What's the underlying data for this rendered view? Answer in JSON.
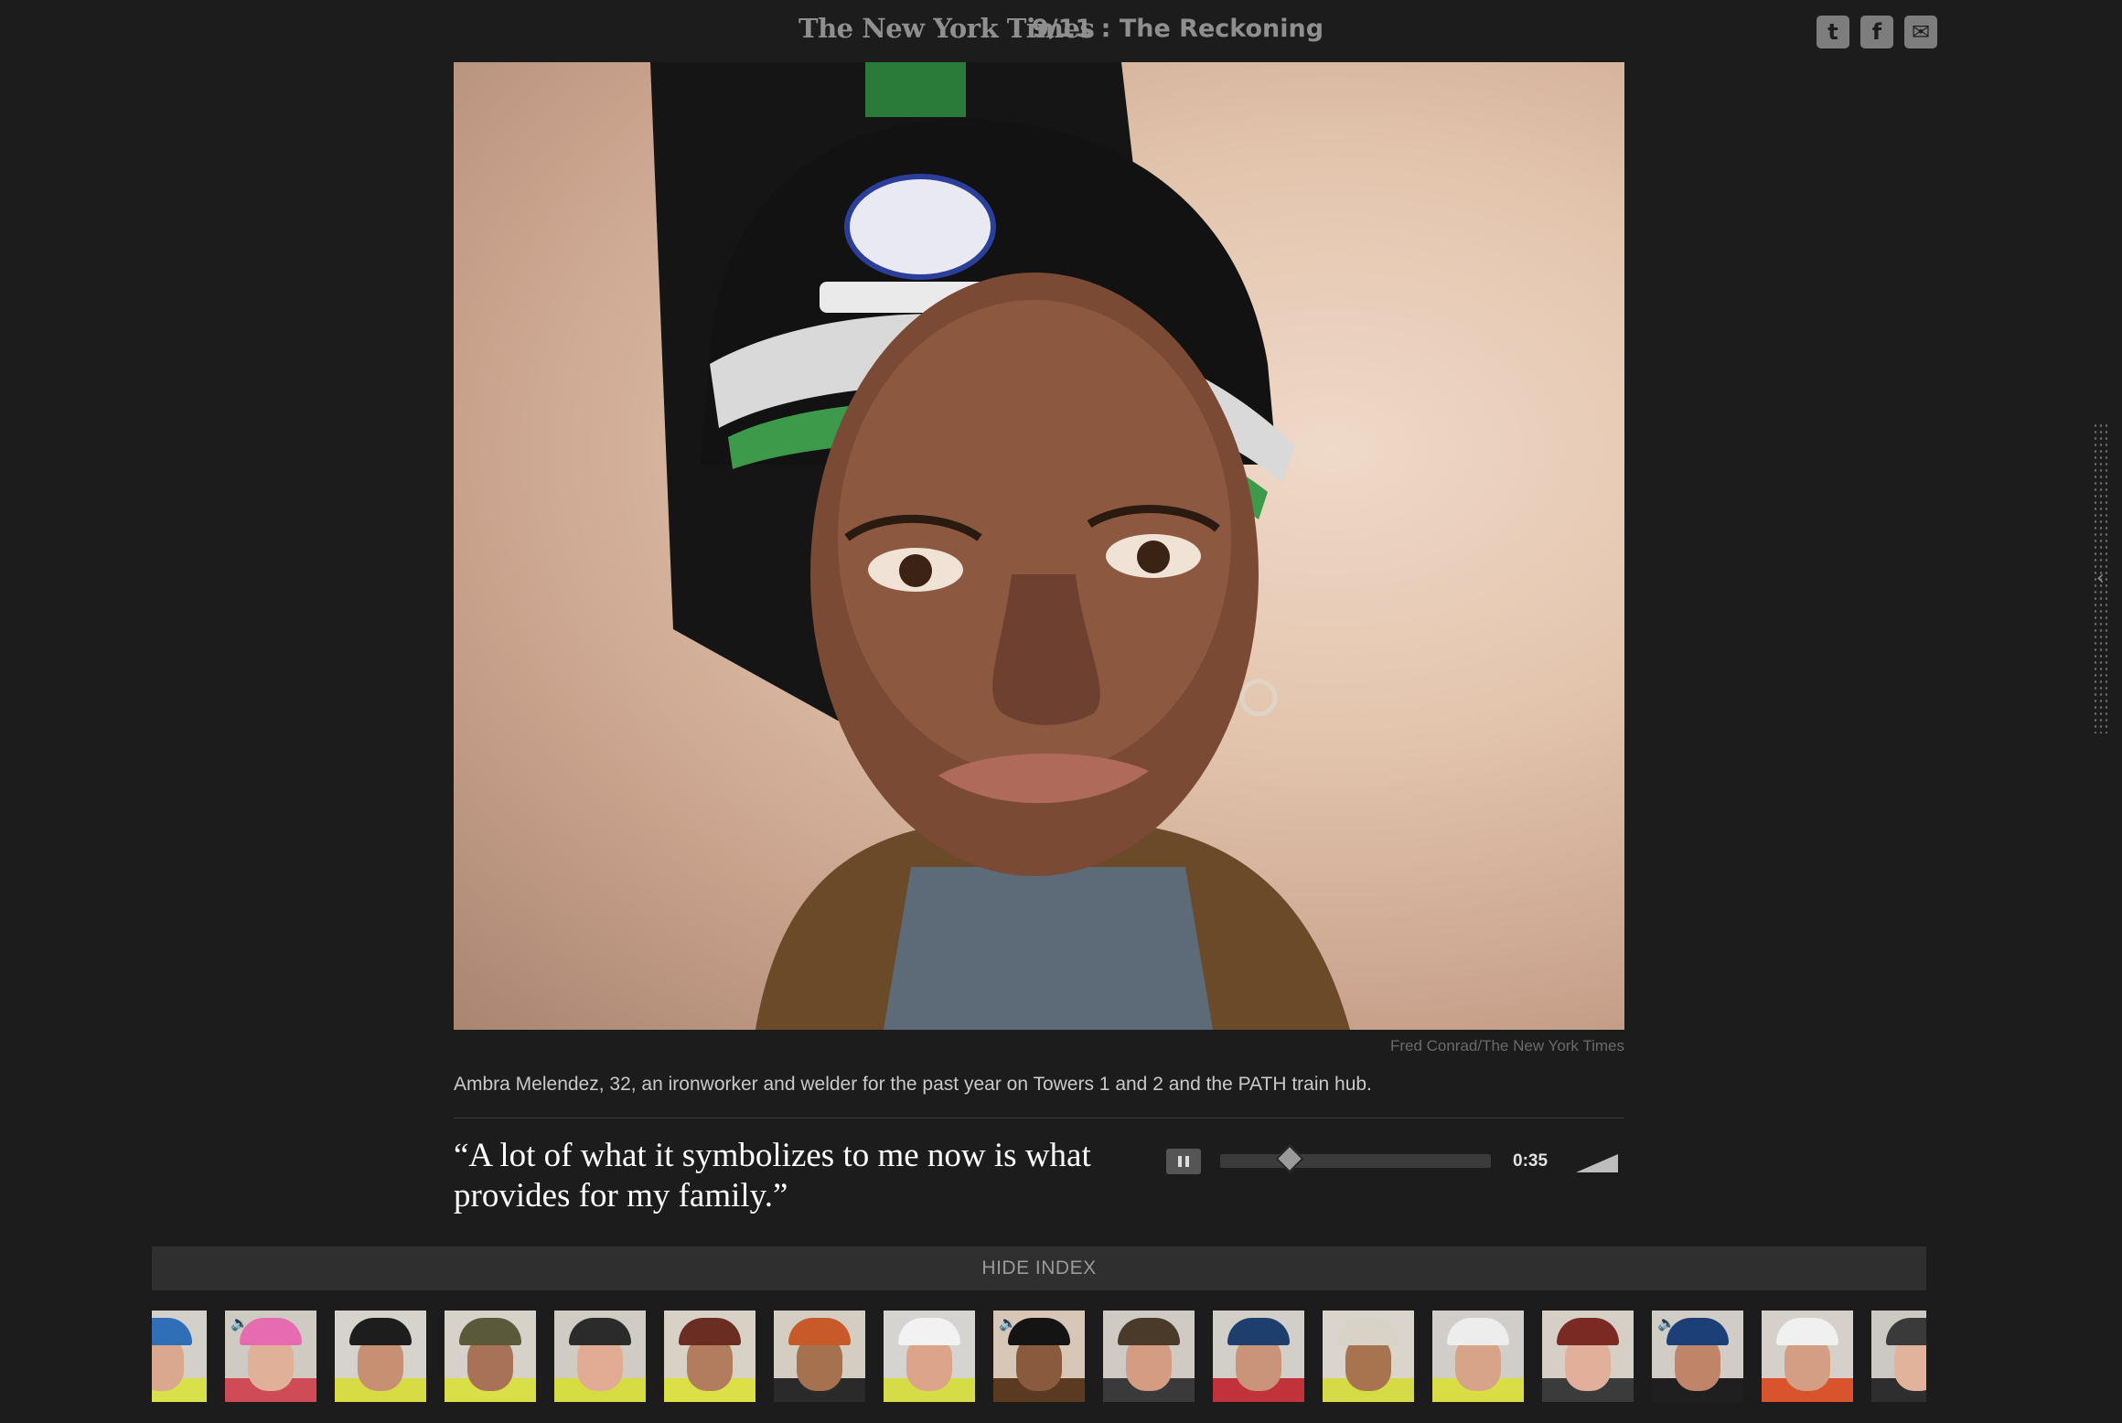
{
  "header": {
    "masthead": "The New York Times",
    "series_title": "9/11 : The Reckoning",
    "share": [
      {
        "icon": "twitter-icon",
        "glyph": "t"
      },
      {
        "icon": "facebook-icon",
        "glyph": "f"
      },
      {
        "icon": "email-icon",
        "glyph": "✉"
      }
    ]
  },
  "photo": {
    "credit": "Fred Conrad/The New York Times",
    "caption": "Ambra Melendez, 32, an ironworker and welder for the past year on Towers 1 and 2 and the PATH train hub."
  },
  "quote": "“A lot of what it symbolizes to me now is what provides for my family.”",
  "audio": {
    "state": "playing",
    "elapsed": "0:35",
    "progress": 0.25
  },
  "index": {
    "toggle_label": "HIDE INDEX"
  },
  "thumbnails": [
    {
      "hat": "#2f6fb8",
      "skin": "#d9a88e",
      "vest": "#d8e04a",
      "bg": "#d3cfc9",
      "audio": false,
      "partial": true
    },
    {
      "hat": "#e76bb0",
      "skin": "#e0b098",
      "vest": "#cf4b55",
      "bg": "#cfcac2",
      "audio": true
    },
    {
      "hat": "#1d1d1d",
      "skin": "#c89072",
      "vest": "#d7dc44",
      "bg": "#d6d3cd",
      "audio": false
    },
    {
      "hat": "#5a5a3a",
      "skin": "#a87256",
      "vest": "#d9df46",
      "bg": "#d6d1c9",
      "audio": false
    },
    {
      "hat": "#2b2b2b",
      "skin": "#e2ac94",
      "vest": "#d6dd43",
      "bg": "#d0ccc4",
      "audio": false
    },
    {
      "hat": "#6b2c22",
      "skin": "#b27c5e",
      "vest": "#dbe047",
      "bg": "#d8d2c6",
      "audio": false
    },
    {
      "hat": "#c85a2a",
      "skin": "#a5714f",
      "vest": "#2a2a2a",
      "bg": "#d4cdc2",
      "audio": false
    },
    {
      "hat": "#f2f2f2",
      "skin": "#dca58a",
      "vest": "#d6dc45",
      "bg": "#d6d4d0",
      "audio": false
    },
    {
      "hat": "#141414",
      "skin": "#8a5a3c",
      "vest": "#5b3a22",
      "bg": "#d8c7b7",
      "audio": true
    },
    {
      "hat": "#4a3a2a",
      "skin": "#d49c80",
      "vest": "#3a3a3a",
      "bg": "#cfcbc4",
      "audio": false
    },
    {
      "hat": "#1e3f6e",
      "skin": "#c99478",
      "vest": "#c2323a",
      "bg": "#d2cec8",
      "audio": false
    },
    {
      "hat": "#d9d2c7",
      "skin": "#a8744f",
      "vest": "#d4db46",
      "bg": "#d9d5cd",
      "audio": false
    },
    {
      "hat": "#ededed",
      "skin": "#d7a488",
      "vest": "#d8de44",
      "bg": "#d1cec9",
      "audio": false
    },
    {
      "hat": "#7a2a22",
      "skin": "#e2b09a",
      "vest": "#3b3b3b",
      "bg": "#d5cfc6",
      "audio": false
    },
    {
      "hat": "#1c3f78",
      "skin": "#c08468",
      "vest": "#1f1f1f",
      "bg": "#d1ccc5",
      "audio": true
    },
    {
      "hat": "#f0f0f0",
      "skin": "#d49e82",
      "vest": "#d9542c",
      "bg": "#d5d1ca",
      "audio": false
    },
    {
      "hat": "#3a3a3a",
      "skin": "#e1b39b",
      "vest": "#2e2e2e",
      "bg": "#ccc8c2",
      "audio": false,
      "partial": true
    }
  ]
}
